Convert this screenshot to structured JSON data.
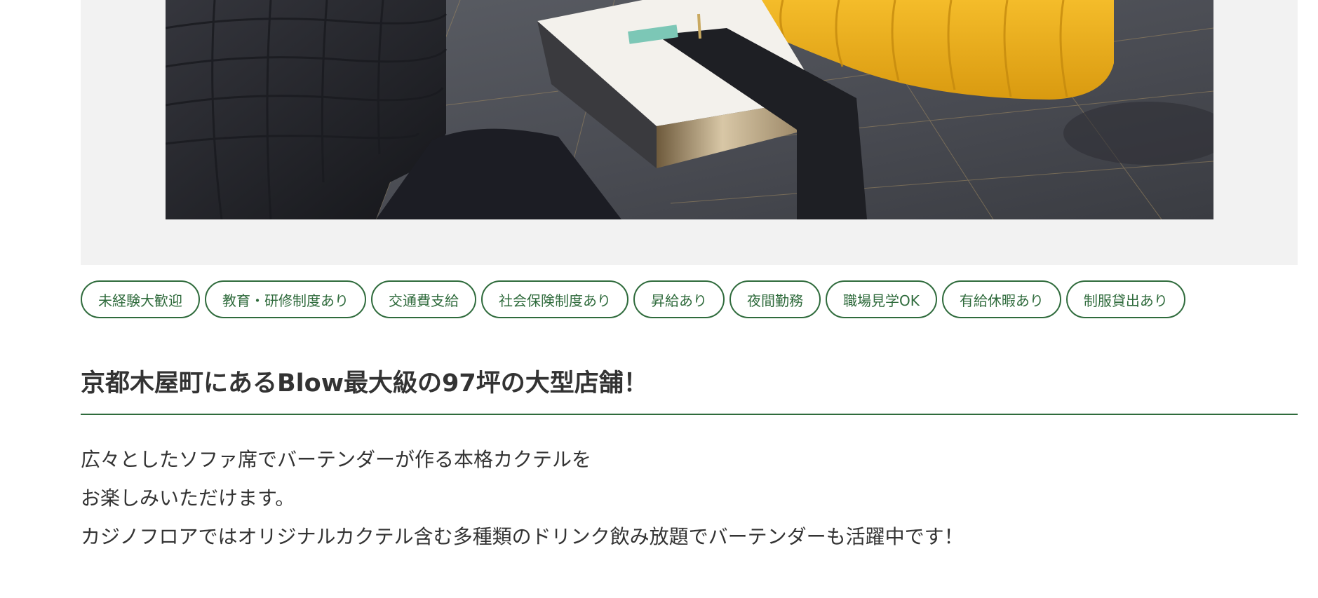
{
  "tags": [
    "未経験大歓迎",
    "教育・研修制度あり",
    "交通費支給",
    "社会保険制度あり",
    "昇給あり",
    "夜間勤務",
    "職場見学OK",
    "有給休暇あり",
    "制服貸出あり"
  ],
  "heading": "京都木屋町にあるBlow最大級の97坪の大型店舗！",
  "description": {
    "line1": "広々としたソファ席でバーテンダーが作る本格カクテルを",
    "line2": "お楽しみいただけます。",
    "line3": "カジノフロアではオリジナルカクテル含む多種類のドリンク飲み放題でバーテンダーも活躍中です！"
  },
  "colors": {
    "accent": "#2f6b3c",
    "photo_frame_bg": "#f2f2f2",
    "sofa_yellow": "#f0b21a",
    "sofa_dark": "#2b2c33"
  }
}
